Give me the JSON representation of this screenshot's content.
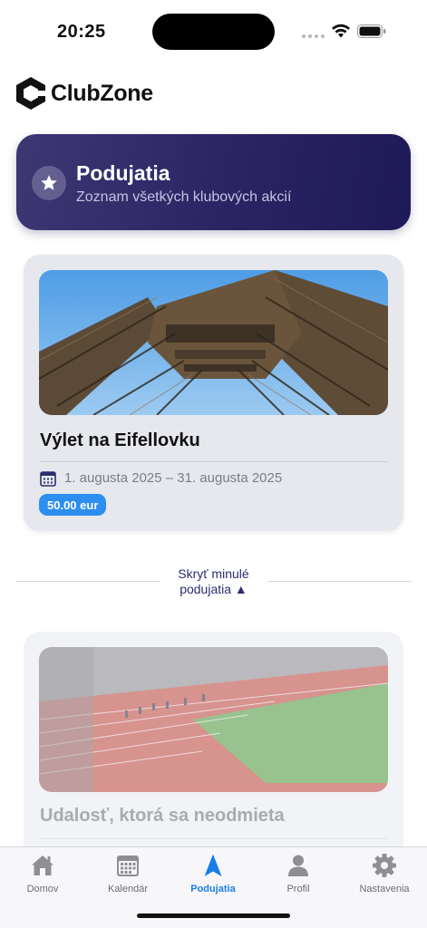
{
  "status_bar": {
    "time": "20:25"
  },
  "app": {
    "logo_text": "ClubZone"
  },
  "banner": {
    "title": "Podujatia",
    "subtitle": "Zoznam všetkých klubových akcií",
    "icon": "star-icon"
  },
  "events": [
    {
      "title": "Výlet na Eifellovku",
      "date": "1. augusta 2025 – 31. augusta 2025",
      "price": "50.00 eur",
      "image": "eiffel-tower-photo"
    }
  ],
  "past_toggle": {
    "label_line1": "Skryť minulé",
    "label_line2": "podujatia ▲"
  },
  "past_events": [
    {
      "title": "Udalosť, ktorá sa neodmieta",
      "image": "athletics-stadium-photo"
    }
  ],
  "tabbar": {
    "items": [
      {
        "label": "Domov",
        "icon": "home-icon"
      },
      {
        "label": "Kalendár",
        "icon": "calendar-icon"
      },
      {
        "label": "Podujatia",
        "icon": "navigation-arrow-icon"
      },
      {
        "label": "Profil",
        "icon": "person-icon"
      },
      {
        "label": "Nastavenia",
        "icon": "gear-icon"
      }
    ],
    "active_index": 2
  },
  "colors": {
    "banner_start": "#3d3773",
    "banner_end": "#1e1957",
    "accent": "#1a7ee8",
    "price_badge": "#2d8ef0"
  }
}
